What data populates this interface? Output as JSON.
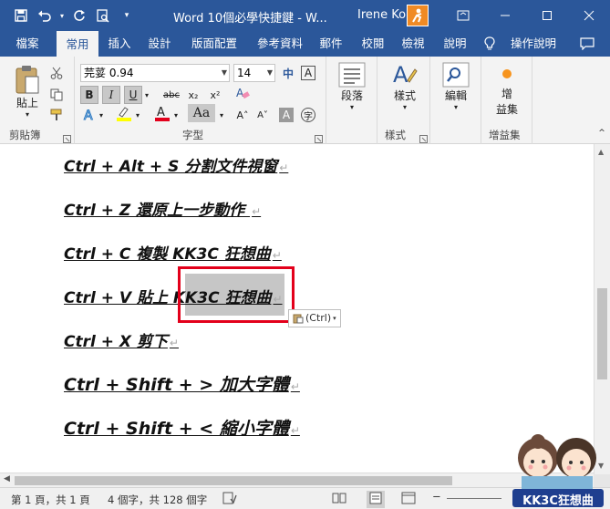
{
  "titlebar": {
    "title": "Word 10個必學快捷鍵 - W...",
    "user": "Irene Ko"
  },
  "tabs": [
    {
      "label": "檔案"
    },
    {
      "label": "常用"
    },
    {
      "label": "插入"
    },
    {
      "label": "設計"
    },
    {
      "label": "版面配置"
    },
    {
      "label": "參考資料"
    },
    {
      "label": "郵件"
    },
    {
      "label": "校閱"
    },
    {
      "label": "檢視"
    },
    {
      "label": "說明"
    },
    {
      "label": "操作說明"
    }
  ],
  "ribbon": {
    "clipboard": {
      "paste_label": "貼上",
      "group_label": "剪貼簿"
    },
    "font": {
      "font_name": "芫荽 0.94",
      "font_size": "14",
      "group_label": "字型",
      "bold": "B",
      "italic": "I",
      "underline": "U",
      "strike": "abc",
      "subscript": "x₂",
      "superscript": "x²",
      "grow": "A˄",
      "shrink": "A˅",
      "zhuyin": "中",
      "char_border": "A",
      "char_shade": "A",
      "enclose": "字"
    },
    "paragraph": {
      "label": "段落"
    },
    "styles": {
      "label": "樣式",
      "group_label": "樣式"
    },
    "editing": {
      "label": "編輯"
    },
    "addins": {
      "label_top": "增",
      "label_bottom": "益集",
      "group_label": "增益集"
    }
  },
  "document": {
    "lines": [
      {
        "text": "Ctrl + Alt + S  分割文件視窗"
      },
      {
        "text": "Ctrl + Z  還原上一步動作 "
      },
      {
        "text": "Ctrl + C  複製   KK3C 狂想曲"
      },
      {
        "text": "Ctrl + V  貼上   KK3C 狂想曲"
      },
      {
        "text": "Ctrl + X  剪下"
      },
      {
        "text": "Ctrl + Shift + >  加大字體"
      },
      {
        "text": "Ctrl + Shift + <  縮小字體"
      }
    ],
    "paste_tag": "(Ctrl)"
  },
  "statusbar": {
    "page": "第 1 頁，共 1 頁",
    "words": "4 個字，共 128 個字"
  },
  "watermark": {
    "text": "KK3C狂想曲"
  },
  "colors": {
    "accent": "#2b579a",
    "highlight": "#e3001b"
  }
}
